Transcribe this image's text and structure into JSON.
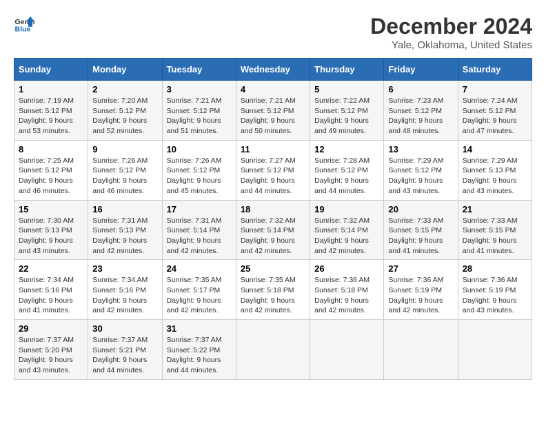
{
  "header": {
    "logo_line1": "General",
    "logo_line2": "Blue",
    "title": "December 2024",
    "subtitle": "Yale, Oklahoma, United States"
  },
  "calendar": {
    "weekdays": [
      "Sunday",
      "Monday",
      "Tuesday",
      "Wednesday",
      "Thursday",
      "Friday",
      "Saturday"
    ],
    "weeks": [
      [
        {
          "day": 1,
          "sunrise": "7:19 AM",
          "sunset": "5:12 PM",
          "daylight": "9 hours and 53 minutes."
        },
        {
          "day": 2,
          "sunrise": "7:20 AM",
          "sunset": "5:12 PM",
          "daylight": "9 hours and 52 minutes."
        },
        {
          "day": 3,
          "sunrise": "7:21 AM",
          "sunset": "5:12 PM",
          "daylight": "9 hours and 51 minutes."
        },
        {
          "day": 4,
          "sunrise": "7:21 AM",
          "sunset": "5:12 PM",
          "daylight": "9 hours and 50 minutes."
        },
        {
          "day": 5,
          "sunrise": "7:22 AM",
          "sunset": "5:12 PM",
          "daylight": "9 hours and 49 minutes."
        },
        {
          "day": 6,
          "sunrise": "7:23 AM",
          "sunset": "5:12 PM",
          "daylight": "9 hours and 48 minutes."
        },
        {
          "day": 7,
          "sunrise": "7:24 AM",
          "sunset": "5:12 PM",
          "daylight": "9 hours and 47 minutes."
        }
      ],
      [
        {
          "day": 8,
          "sunrise": "7:25 AM",
          "sunset": "5:12 PM",
          "daylight": "9 hours and 46 minutes."
        },
        {
          "day": 9,
          "sunrise": "7:26 AM",
          "sunset": "5:12 PM",
          "daylight": "9 hours and 46 minutes."
        },
        {
          "day": 10,
          "sunrise": "7:26 AM",
          "sunset": "5:12 PM",
          "daylight": "9 hours and 45 minutes."
        },
        {
          "day": 11,
          "sunrise": "7:27 AM",
          "sunset": "5:12 PM",
          "daylight": "9 hours and 44 minutes."
        },
        {
          "day": 12,
          "sunrise": "7:28 AM",
          "sunset": "5:12 PM",
          "daylight": "9 hours and 44 minutes."
        },
        {
          "day": 13,
          "sunrise": "7:29 AM",
          "sunset": "5:12 PM",
          "daylight": "9 hours and 43 minutes."
        },
        {
          "day": 14,
          "sunrise": "7:29 AM",
          "sunset": "5:13 PM",
          "daylight": "9 hours and 43 minutes."
        }
      ],
      [
        {
          "day": 15,
          "sunrise": "7:30 AM",
          "sunset": "5:13 PM",
          "daylight": "9 hours and 43 minutes."
        },
        {
          "day": 16,
          "sunrise": "7:31 AM",
          "sunset": "5:13 PM",
          "daylight": "9 hours and 42 minutes."
        },
        {
          "day": 17,
          "sunrise": "7:31 AM",
          "sunset": "5:14 PM",
          "daylight": "9 hours and 42 minutes."
        },
        {
          "day": 18,
          "sunrise": "7:32 AM",
          "sunset": "5:14 PM",
          "daylight": "9 hours and 42 minutes."
        },
        {
          "day": 19,
          "sunrise": "7:32 AM",
          "sunset": "5:14 PM",
          "daylight": "9 hours and 42 minutes."
        },
        {
          "day": 20,
          "sunrise": "7:33 AM",
          "sunset": "5:15 PM",
          "daylight": "9 hours and 41 minutes."
        },
        {
          "day": 21,
          "sunrise": "7:33 AM",
          "sunset": "5:15 PM",
          "daylight": "9 hours and 41 minutes."
        }
      ],
      [
        {
          "day": 22,
          "sunrise": "7:34 AM",
          "sunset": "5:16 PM",
          "daylight": "9 hours and 41 minutes."
        },
        {
          "day": 23,
          "sunrise": "7:34 AM",
          "sunset": "5:16 PM",
          "daylight": "9 hours and 42 minutes."
        },
        {
          "day": 24,
          "sunrise": "7:35 AM",
          "sunset": "5:17 PM",
          "daylight": "9 hours and 42 minutes."
        },
        {
          "day": 25,
          "sunrise": "7:35 AM",
          "sunset": "5:18 PM",
          "daylight": "9 hours and 42 minutes."
        },
        {
          "day": 26,
          "sunrise": "7:36 AM",
          "sunset": "5:18 PM",
          "daylight": "9 hours and 42 minutes."
        },
        {
          "day": 27,
          "sunrise": "7:36 AM",
          "sunset": "5:19 PM",
          "daylight": "9 hours and 42 minutes."
        },
        {
          "day": 28,
          "sunrise": "7:36 AM",
          "sunset": "5:19 PM",
          "daylight": "9 hours and 43 minutes."
        }
      ],
      [
        {
          "day": 29,
          "sunrise": "7:37 AM",
          "sunset": "5:20 PM",
          "daylight": "9 hours and 43 minutes."
        },
        {
          "day": 30,
          "sunrise": "7:37 AM",
          "sunset": "5:21 PM",
          "daylight": "9 hours and 44 minutes."
        },
        {
          "day": 31,
          "sunrise": "7:37 AM",
          "sunset": "5:22 PM",
          "daylight": "9 hours and 44 minutes."
        },
        null,
        null,
        null,
        null
      ]
    ]
  }
}
